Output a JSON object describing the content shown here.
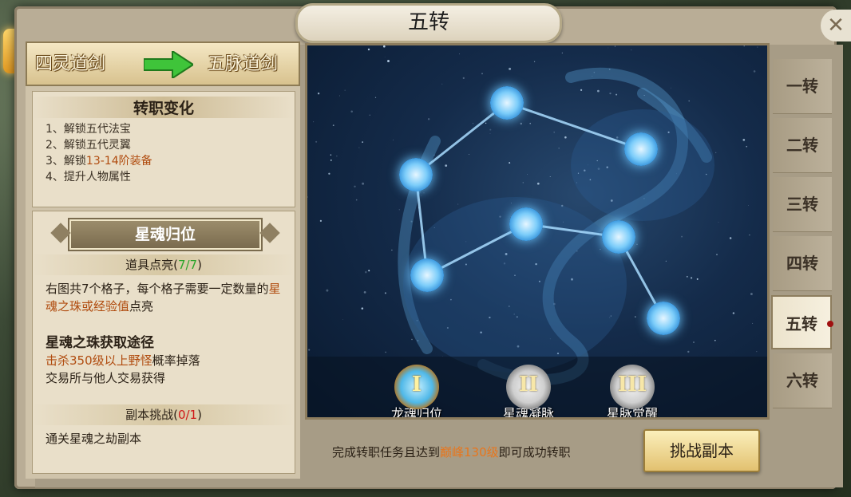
{
  "window": {
    "title": "五转",
    "close_icon": "close-icon"
  },
  "job_bar": {
    "from": "四灵道剑",
    "to": "五脉道剑"
  },
  "changes": {
    "title": "转职变化",
    "items": [
      {
        "prefix": "1、解锁五代法宝",
        "highlight": "",
        "suffix": ""
      },
      {
        "prefix": "2、解锁五代灵翼",
        "highlight": "",
        "suffix": ""
      },
      {
        "prefix": "3、解锁",
        "highlight": "13-14阶装备",
        "suffix": ""
      },
      {
        "prefix": "4、提升人物属性",
        "highlight": "",
        "suffix": ""
      }
    ]
  },
  "star_soul": {
    "banner": "星魂归位",
    "items_title": "道具点亮",
    "items_progress": "7/7",
    "desc_prefix": "右图共7个格子，每个格子需要一定数量的",
    "desc_highlight": "星魂之珠或经验值",
    "desc_suffix": "点亮",
    "source_title": "星魂之珠获取途径",
    "source_line1": "击杀350级以上野怪",
    "source_line1_suffix": "概率掉落",
    "source_line2": "交易所与他人交易获得",
    "dungeon_title": "副本挑战",
    "dungeon_progress": "0/1",
    "dungeon_desc": "通关星魂之劫副本"
  },
  "stages": [
    {
      "numeral": "I",
      "label": "龙魂归位",
      "active": true
    },
    {
      "numeral": "II",
      "label": "星魂凝脉",
      "active": false
    },
    {
      "numeral": "III",
      "label": "星脉觉醒",
      "active": false
    }
  ],
  "footer": {
    "text_prefix": "完成转职任务且达到",
    "text_highlight": "巅峰130级",
    "text_suffix": "即可成功转职",
    "button": "挑战副本"
  },
  "tabs": [
    "一转",
    "二转",
    "三转",
    "四转",
    "五转",
    "六转"
  ],
  "active_tab": "五转"
}
